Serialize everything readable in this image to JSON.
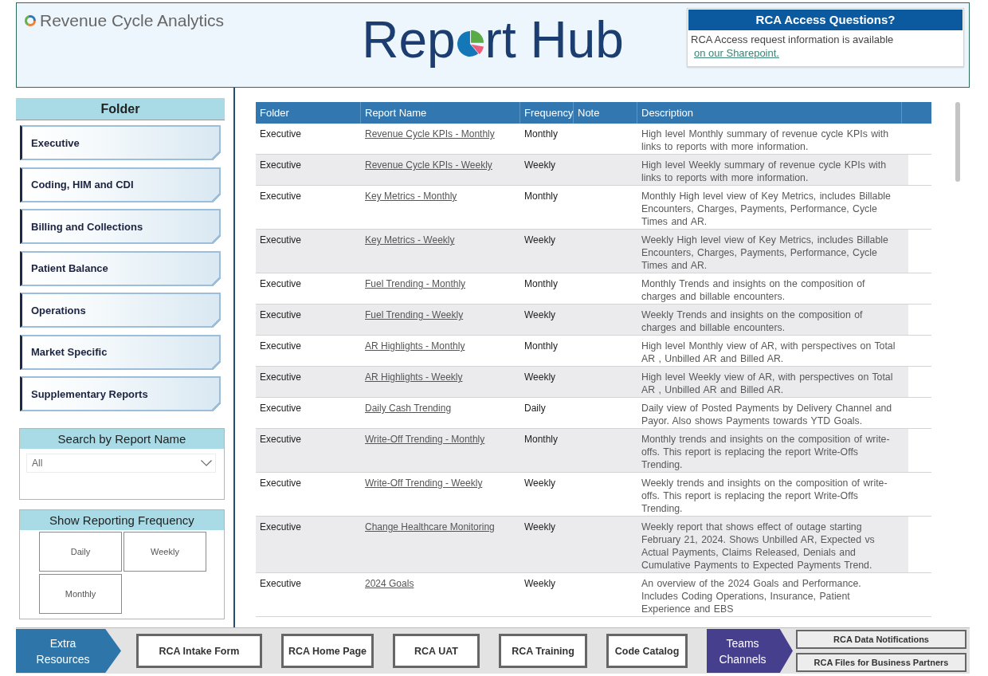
{
  "header": {
    "logo_text": "Revenue Cycle Analytics",
    "title": {
      "lead": "Rep",
      "tail": "rt Hub"
    },
    "access_card": {
      "heading": "RCA Access Questions?",
      "text": "RCA Access request information is available",
      "link": "on our Sharepoint."
    }
  },
  "folder_panel": {
    "heading": "Folder",
    "items": [
      "Executive",
      "Coding, HIM and CDI",
      "Billing and Collections",
      "Patient Balance",
      "Operations",
      "Market Specific",
      "Supplementary Reports"
    ]
  },
  "search_panel": {
    "heading": "Search by Report Name",
    "dropdown_value": "All"
  },
  "frequency_panel": {
    "heading": "Show Reporting Frequency",
    "options": [
      {
        "label": "Daily",
        "selected": false
      },
      {
        "label": "Weekly",
        "selected": false
      },
      {
        "label": "Monthly",
        "selected": false
      }
    ]
  },
  "table": {
    "columns": [
      "Folder",
      "Report Name",
      "Frequency",
      "Note",
      "Description"
    ],
    "rows": [
      {
        "folder": "Executive",
        "report_name": "Revenue Cycle KPIs - Monthly",
        "frequency": "Monthly",
        "description": "High level Monthly summary of revenue cycle KPIs with links to reports with more information."
      },
      {
        "folder": "Executive",
        "report_name": "Revenue Cycle KPIs - Weekly",
        "frequency": "Weekly",
        "description": "High level Weekly summary of revenue cycle KPIs with links to reports with more information."
      },
      {
        "folder": "Executive",
        "report_name": "Key Metrics - Monthly",
        "frequency": "Monthly",
        "description": "Monthly High level view of Key Metrics, includes Billable Encounters, Charges, Payments, Performance, Cycle Times and AR."
      },
      {
        "folder": "Executive",
        "report_name": "Key Metrics - Weekly",
        "frequency": "Weekly",
        "description": "Weekly High level view of Key Metrics, includes Billable Encounters, Charges, Payments, Performance, Cycle Times and AR."
      },
      {
        "folder": "Executive",
        "report_name": "Fuel Trending - Monthly",
        "frequency": "Monthly",
        "description": "Monthly Trends and insights on the composition of charges and billable encounters."
      },
      {
        "folder": "Executive",
        "report_name": "Fuel Trending - Weekly",
        "frequency": "Weekly",
        "description": "Weekly Trends and insights on the composition of charges and billable encounters."
      },
      {
        "folder": "Executive",
        "report_name": "AR Highlights - Monthly",
        "frequency": "Monthly",
        "description": "High level Monthly view of AR, with perspectives on Total AR , Unbilled AR and Billed AR."
      },
      {
        "folder": "Executive",
        "report_name": "AR Highlights - Weekly",
        "frequency": "Weekly",
        "description": "High level Weekly view of AR, with perspectives on Total AR , Unbilled AR and Billed AR."
      },
      {
        "folder": "Executive",
        "report_name": "Daily Cash Trending",
        "frequency": "Daily",
        "description": "Daily view of Posted Payments by Delivery Channel and Payor. Also shows Payments towards YTD Goals."
      },
      {
        "folder": "Executive",
        "report_name": "Write-Off Trending - Monthly",
        "frequency": "Monthly",
        "description": "Monthly trends and insights on the composition of write-offs. This report is replacing the report Write-Offs Trending."
      },
      {
        "folder": "Executive",
        "report_name": "Write-Off Trending - Weekly",
        "frequency": "Weekly",
        "description": "Weekly trends and insights on the composition of write-offs. This report is replacing the report Write-Offs Trending."
      },
      {
        "folder": "Executive",
        "report_name": "Change Healthcare Monitoring",
        "frequency": "Weekly",
        "description": "Weekly report that shows effect of outage starting February 21, 2024. Shows Unbilled AR, Expected vs Actual Payments, Claims Released, Denials and Cumulative Payments to Expected Payments Trend."
      },
      {
        "folder": "Executive",
        "report_name": "2024 Goals",
        "frequency": "Weekly",
        "description": "An overview of the 2024 Goals and Performance. Includes Coding Operations, Insurance, Patient Experience and EBS"
      }
    ]
  },
  "footer": {
    "extra_resources": {
      "label": "Extra Resources",
      "links": [
        "RCA Intake Form",
        "RCA Home Page",
        "RCA UAT",
        "RCA Training",
        "Code Catalog"
      ]
    },
    "teams": {
      "label": "Teams Channels",
      "links": [
        "RCA Data Notifications",
        "RCA Files for Business Partners"
      ]
    }
  }
}
